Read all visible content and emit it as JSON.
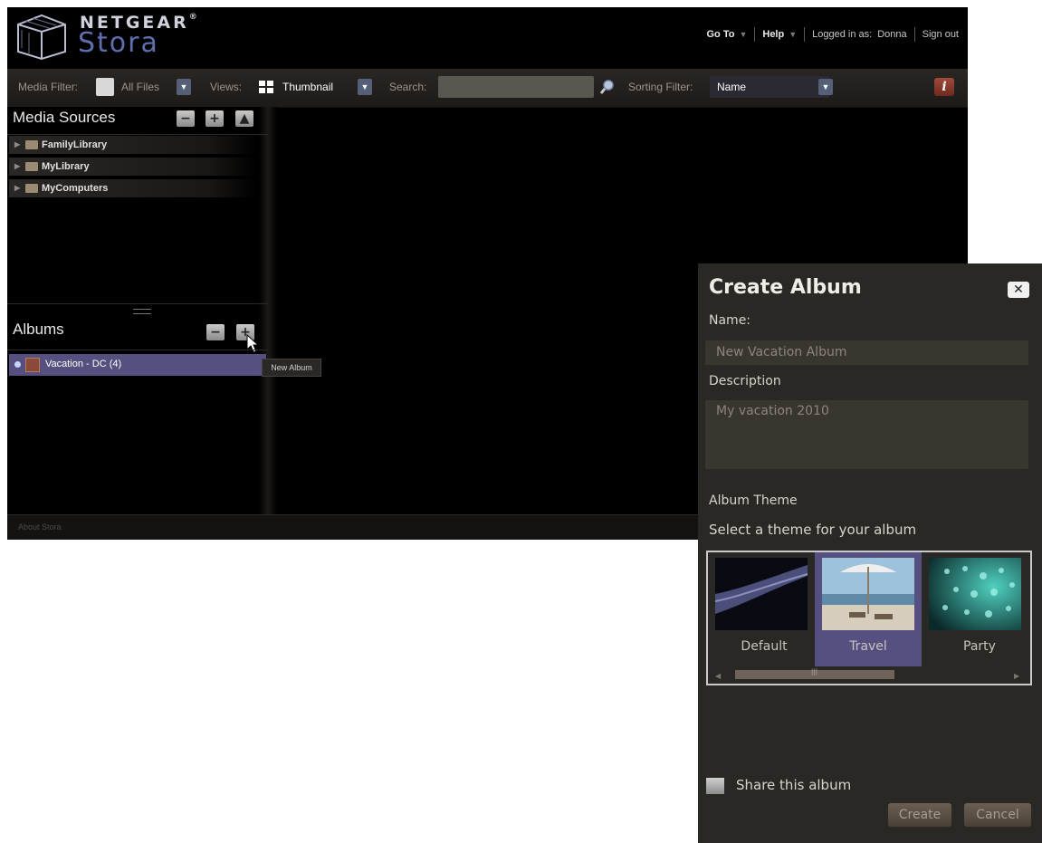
{
  "brand": {
    "top": "NETGEAR",
    "reg": "®",
    "bottom": "Stora"
  },
  "topnav": {
    "goto": "Go To",
    "help": "Help",
    "logged_in_label": "Logged in as:",
    "user": "Donna",
    "sign_out": "Sign out"
  },
  "toolbar": {
    "media_filter_label": "Media Filter:",
    "media_filter_value": "All Files",
    "views_label": "Views:",
    "views_value": "Thumbnail",
    "search_label": "Search:",
    "search_value": "",
    "sorting_label": "Sorting Filter:",
    "sorting_value": "Name",
    "info": "i"
  },
  "media_sources": {
    "title": "Media Sources",
    "items": [
      {
        "label": "FamilyLibrary"
      },
      {
        "label": "MyLibrary"
      },
      {
        "label": "MyComputers"
      }
    ]
  },
  "albums": {
    "title": "Albums",
    "items": [
      {
        "label": "Vacation - DC (4)"
      }
    ],
    "tooltip": "New Album"
  },
  "footer": {
    "about": "About Stora"
  },
  "dialog": {
    "title": "Create Album",
    "name_label": "Name:",
    "name_value": "New Vacation Album",
    "description_label": "Description",
    "description_value": "My vacation 2010",
    "theme_label": "Album Theme",
    "theme_hint": "Select a theme for your album",
    "themes": [
      {
        "label": "Default"
      },
      {
        "label": "Travel"
      },
      {
        "label": "Party"
      }
    ],
    "selected_theme": "Travel",
    "share_label": "Share this album",
    "create_label": "Create",
    "cancel_label": "Cancel"
  },
  "colors": {
    "accent": "#55507f",
    "selection": "#4c4a7a"
  }
}
